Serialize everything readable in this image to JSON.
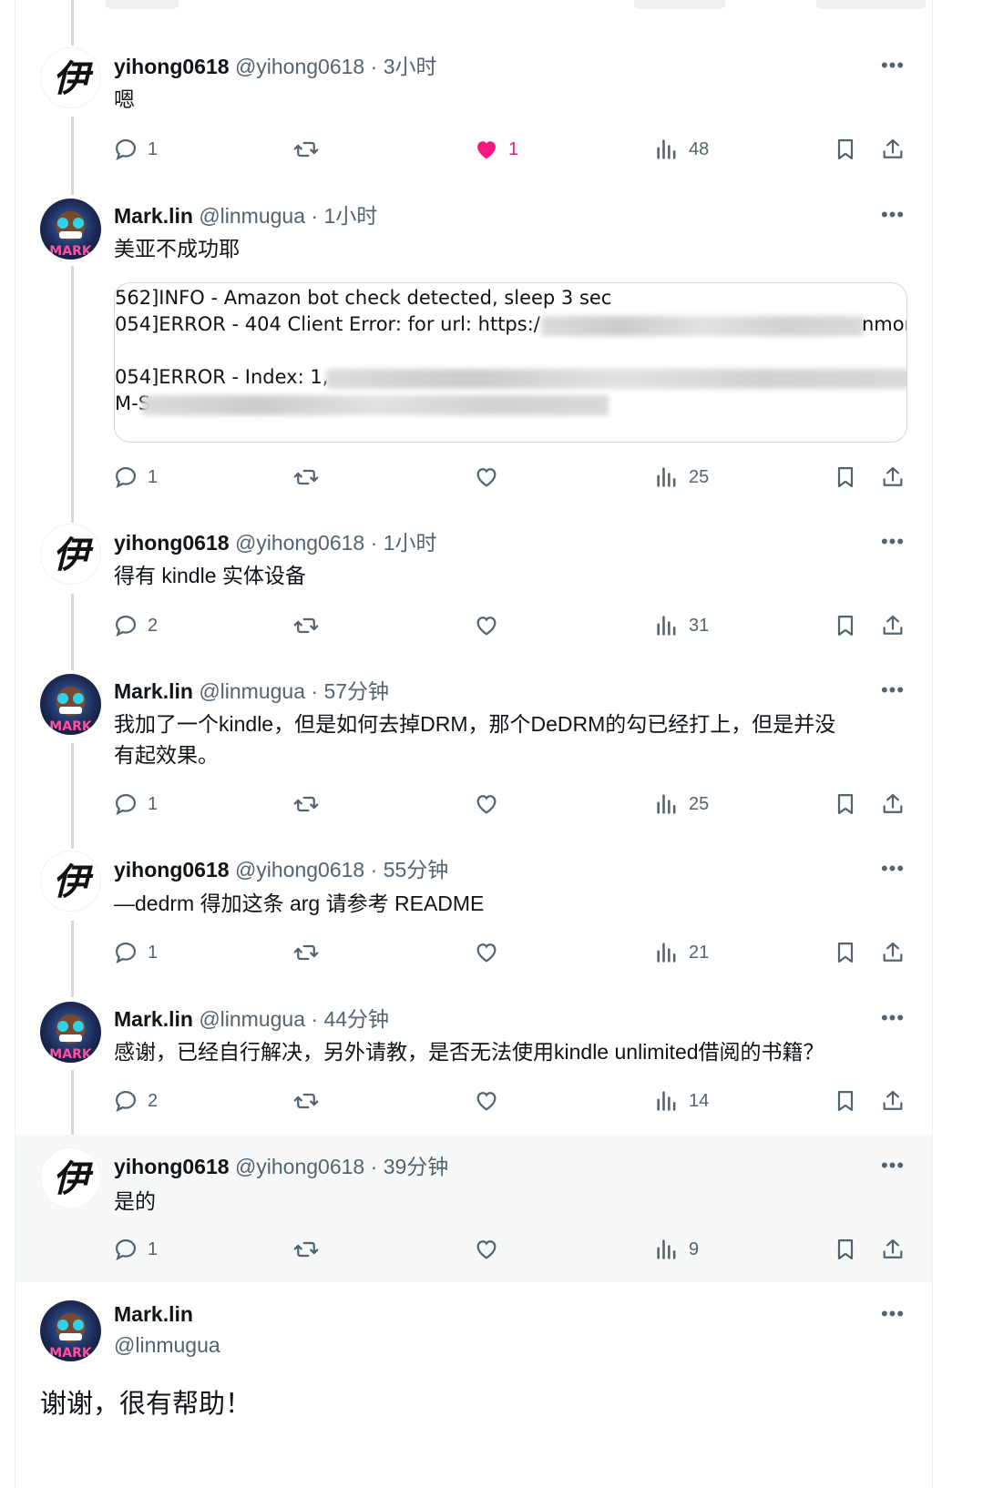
{
  "tweets": [
    {
      "name": "yihong0618",
      "handle": "@yihong0618",
      "time": "3小时",
      "text": "嗯",
      "reply": "1",
      "like": "1",
      "views": "48",
      "liked": true
    },
    {
      "name": "Mark.lin",
      "handle": "@linmugua",
      "time": "1小时",
      "text": "美亚不成功耶",
      "reply": "1",
      "like": "",
      "views": "25",
      "media_lines": [
        "562]INFO - Amazon bot check detected, sleep 3 sec",
        "054]ERROR - 404 Client Error:  for url: https:/",
        "nmor",
        "054]ERROR - Index: 1,",
        "M-S"
      ]
    },
    {
      "name": "yihong0618",
      "handle": "@yihong0618",
      "time": "1小时",
      "text": "得有 kindle 实体设备",
      "reply": "2",
      "like": "",
      "views": "31"
    },
    {
      "name": "Mark.lin",
      "handle": "@linmugua",
      "time": "57分钟",
      "text_line1": "我加了一个kindle，但是如何去掉DRM，那个DeDRM的勾已经打上，但是并没",
      "text_line2": "有起效果。",
      "reply": "1",
      "like": "",
      "views": "25"
    },
    {
      "name": "yihong0618",
      "handle": "@yihong0618",
      "time": "55分钟",
      "text": "—dedrm 得加这条 arg 请参考 README",
      "reply": "1",
      "like": "",
      "views": "21"
    },
    {
      "name": "Mark.lin",
      "handle": "@linmugua",
      "time": "44分钟",
      "text": "感谢，已经自行解决，另外请教，是否无法使用kindle unlimited借阅的书籍？",
      "reply": "2",
      "like": "",
      "views": "14"
    },
    {
      "name": "yihong0618",
      "handle": "@yihong0618",
      "time": "39分钟",
      "text": "是的",
      "reply": "1",
      "like": "",
      "views": "9"
    }
  ],
  "final": {
    "name": "Mark.lin",
    "handle": "@linmugua",
    "text": "谢谢，很有帮助！"
  },
  "separator": "·",
  "more_glyph": "•••",
  "avatar_glyph": "伊",
  "avatar_mark_text": "MARK",
  "colors": {
    "like": "#f91880",
    "secondary": "#536471",
    "thread_line": "#cfd9de"
  }
}
